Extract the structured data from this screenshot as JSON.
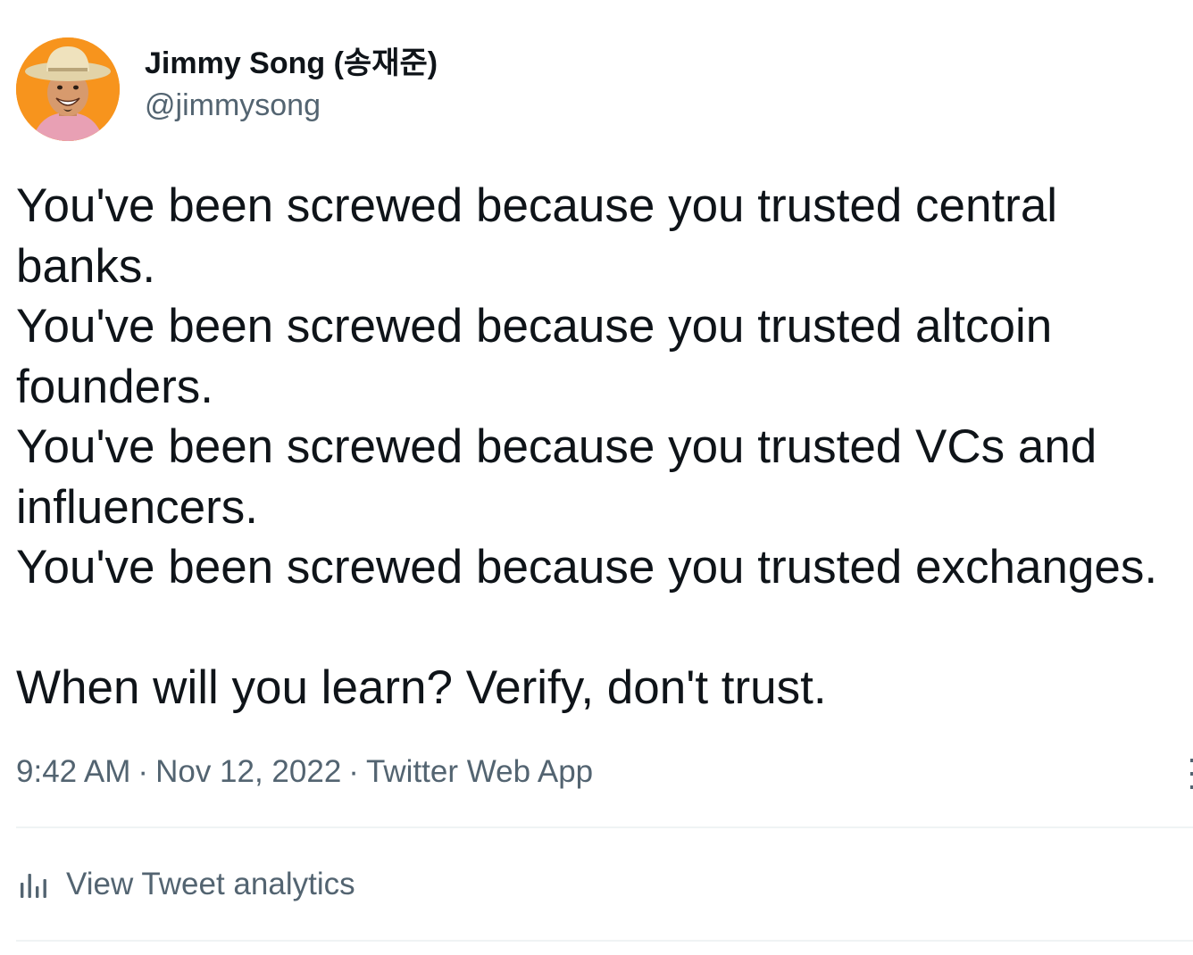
{
  "author": {
    "display_name": "Jimmy Song (송재준)",
    "handle": "@jimmysong",
    "avatar_icon": "cowboy-hat-avatar",
    "avatar_bg": "#f7941d"
  },
  "tweet": {
    "lines": [
      "You've been screwed because you trusted central",
      "banks.",
      "You've been screwed because you trusted altcoin",
      "founders.",
      "You've been screwed because you trusted VCs and",
      "influencers.",
      "You've been screwed because you trusted exchanges.",
      "",
      "When will you learn? Verify, don't trust."
    ]
  },
  "meta": {
    "time": "9:42 AM",
    "separator": "·",
    "date": "Nov 12, 2022",
    "source": "Twitter Web App"
  },
  "analytics": {
    "icon": "bar-chart-icon",
    "label": "View Tweet analytics"
  },
  "colors": {
    "text_primary": "#0f1419",
    "text_secondary": "#536471",
    "divider": "#eff3f4"
  }
}
